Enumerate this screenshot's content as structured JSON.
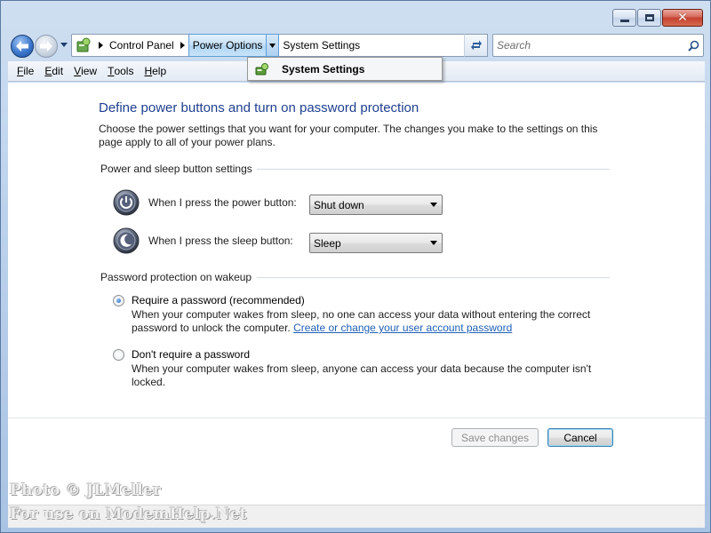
{
  "window": {
    "caption_buttons": {
      "minimize": "minimize",
      "maximize": "maximize",
      "close": "close"
    }
  },
  "nav": {
    "breadcrumbs": [
      "Control Panel",
      "Power Options",
      "System Settings"
    ],
    "search_placeholder": "Search"
  },
  "menu": {
    "items": [
      {
        "label": "File",
        "accel": "F"
      },
      {
        "label": "Edit",
        "accel": "E"
      },
      {
        "label": "View",
        "accel": "V"
      },
      {
        "label": "Tools",
        "accel": "T"
      },
      {
        "label": "Help",
        "accel": "H"
      }
    ]
  },
  "breadcrumb_popup": {
    "item": "System Settings"
  },
  "page": {
    "title": "Define power buttons and turn on password protection",
    "intro": "Choose the power settings that you want for your computer. The changes you make to the settings on this page apply to all of your power plans."
  },
  "power_section": {
    "heading": "Power and sleep button settings",
    "power_button": {
      "label": "When I press the power button:",
      "value": "Shut down"
    },
    "sleep_button": {
      "label": "When I press the sleep button:",
      "value": "Sleep"
    }
  },
  "password_section": {
    "heading": "Password protection on wakeup",
    "require": {
      "label": "Require a password (recommended)",
      "checked": true,
      "desc_prefix": "When your computer wakes from sleep, no one can access your data without entering the correct password to unlock the computer. ",
      "link": "Create or change your user account password"
    },
    "dont_require": {
      "label": "Don't require a password",
      "checked": false,
      "desc": "When your computer wakes from sleep, anyone can access your data because the computer isn't locked."
    }
  },
  "buttons": {
    "save": "Save changes",
    "cancel": "Cancel"
  },
  "watermark": {
    "line1": "Photo © JLMeller",
    "line2": "For use on ModemHelp.Net"
  },
  "colors": {
    "title": "#1e3f8f",
    "link": "#1f5fb4",
    "accent": "#3d78cc"
  }
}
